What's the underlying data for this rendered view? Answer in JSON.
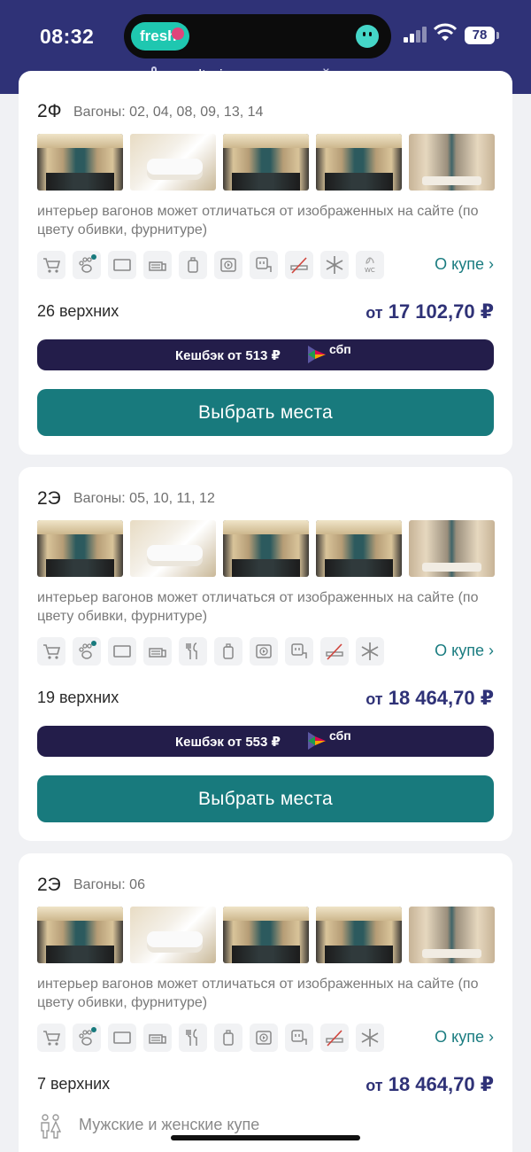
{
  "status_bar": {
    "time": "08:32",
    "app_badge": "fresh",
    "battery": "78",
    "url_host": "grandtrain.ru",
    "url_suffix": " — частный доступ"
  },
  "cards": [
    {
      "class_code": "2Ф",
      "wagons": "Вагоны: 02, 04, 08, 09, 13, 14",
      "disclaimer": "интерьер вагонов может отличаться от изображенных на сайте (по цвету обивки, фурнитуре)",
      "amenities": [
        "cart-icon",
        "pet-icon",
        "tv-icon",
        "bedding-icon",
        "hygiene-kit-icon",
        "media-icon",
        "power-socket-icon",
        "no-smoking-icon",
        "air-conditioning-icon",
        "eco-wc-icon"
      ],
      "coupe_link": "О купе",
      "seats": "26 верхних",
      "price_prefix": "от",
      "price": "17 102,70 ₽",
      "cashback": "Кешбэк от 513 ₽",
      "sbp": "сбп",
      "button": "Выбрать места"
    },
    {
      "class_code": "2Э",
      "wagons": "Вагоны: 05, 10, 11, 12",
      "disclaimer": "интерьер вагонов может отличаться от изображенных на сайте (по цвету обивки, фурнитуре)",
      "amenities": [
        "cart-icon",
        "pet-icon",
        "tv-icon",
        "bedding-icon",
        "meals-icon",
        "hygiene-kit-icon",
        "media-icon",
        "power-socket-icon",
        "no-smoking-icon",
        "air-conditioning-icon"
      ],
      "coupe_link": "О купе",
      "seats": "19 верхних",
      "price_prefix": "от",
      "price": "18 464,70 ₽",
      "cashback": "Кешбэк от 553 ₽",
      "sbp": "сбп",
      "button": "Выбрать места"
    },
    {
      "class_code": "2Э",
      "wagons": "Вагоны: 06",
      "disclaimer": "интерьер вагонов может отличаться от изображенных на сайте (по цвету обивки, фурнитуре)",
      "amenities": [
        "cart-icon",
        "pet-icon",
        "tv-icon",
        "bedding-icon",
        "meals-icon",
        "hygiene-kit-icon",
        "media-icon",
        "power-socket-icon",
        "no-smoking-icon",
        "air-conditioning-icon"
      ],
      "coupe_link": "О купе",
      "seats": "7 верхних",
      "price_prefix": "от",
      "price": "18 464,70 ₽",
      "gender_note": "Мужские и женские купе"
    }
  ],
  "colors": {
    "brand_navy": "#2f3277",
    "teal": "#187a7d",
    "cashback_bg": "#231d4a"
  }
}
